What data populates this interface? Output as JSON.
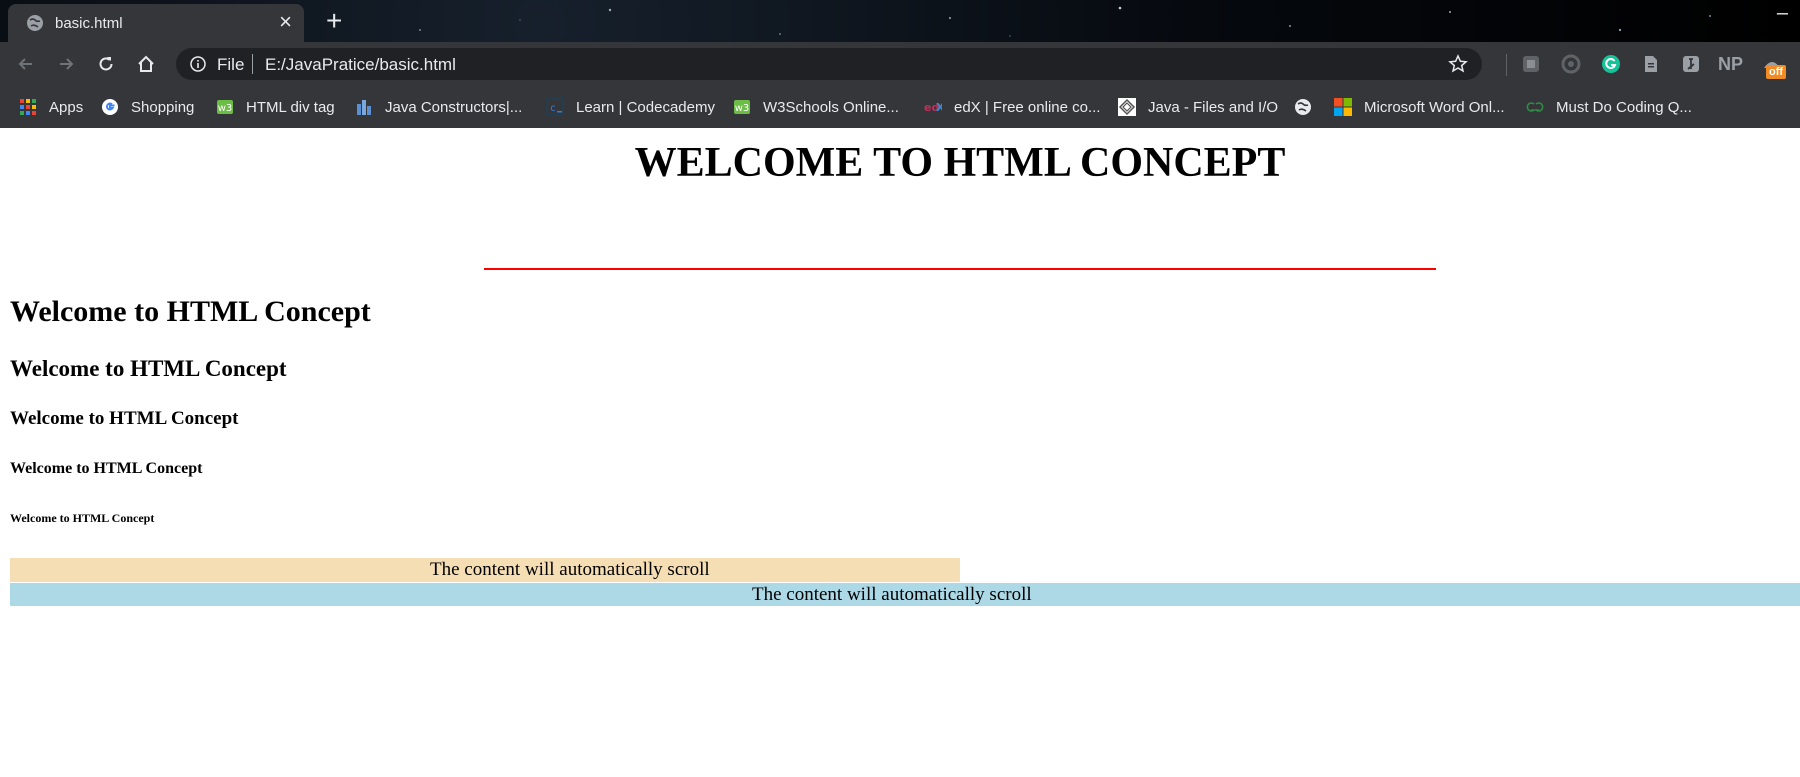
{
  "browser": {
    "tab_title": "basic.html",
    "tab_close": "×",
    "new_tab": "+",
    "minimize": "–",
    "omnibox": {
      "scheme": "File",
      "url": "E:/JavaPratice/basic.html"
    },
    "extension_badge": "off",
    "extension_np_label": "NP",
    "bookmarks": [
      {
        "label": "Apps",
        "icon": "apps-grid-icon"
      },
      {
        "label": "Shopping",
        "icon": "google-icon"
      },
      {
        "label": "HTML div tag",
        "icon": "w3schools-icon"
      },
      {
        "label": "Java Constructors|...",
        "icon": "site-icon"
      },
      {
        "label": "Learn | Codecademy",
        "icon": "codecademy-icon"
      },
      {
        "label": "W3Schools Online...",
        "icon": "w3schools-icon"
      },
      {
        "label": "edX | Free online co...",
        "icon": "edx-icon"
      },
      {
        "label": "Java - Files and I/O",
        "icon": "tutorialspoint-icon"
      },
      {
        "label": "",
        "icon": "globe-icon"
      },
      {
        "label": "Microsoft Word Onl...",
        "icon": "microsoft-icon"
      },
      {
        "label": "Must Do Coding Q...",
        "icon": "geeksforgeeks-icon"
      }
    ]
  },
  "page": {
    "heading_main": "WELCOME TO HTML CONCEPT",
    "headings": [
      "Welcome to HTML Concept",
      "Welcome to HTML Concept",
      "Welcome to HTML Concept",
      "Welcome to HTML Concept",
      "Welcome to HTML Concept"
    ],
    "marquee_1": "The content will automatically scroll",
    "marquee_2": "The content will automatically scroll",
    "colors": {
      "rule": "#ff0000",
      "marquee_1_bg": "#f5deb3",
      "marquee_2_bg": "#add8e6"
    }
  }
}
